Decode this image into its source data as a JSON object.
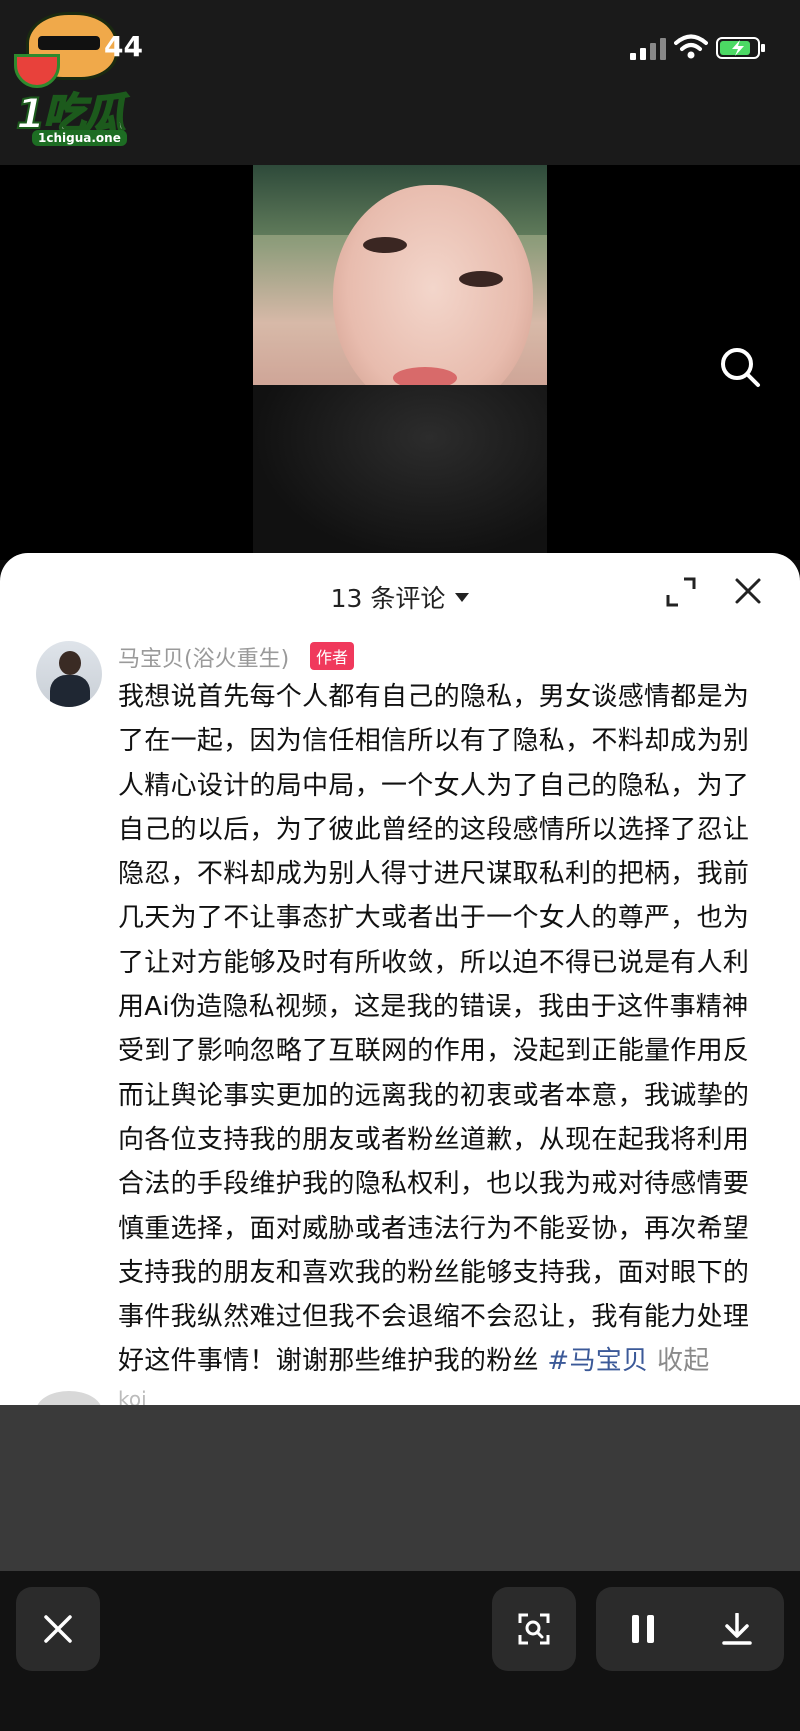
{
  "status_bar": {
    "time": "44",
    "watermark": {
      "brand": "1吃瓜",
      "site": "1chigua.one"
    }
  },
  "comments": {
    "header": "13 条评论",
    "author": {
      "name": "马宝贝(浴火重生)",
      "badge": "作者",
      "text": "我想说首先每个人都有自己的隐私，男女谈感情都是为了在一起，因为信任相信所以有了隐私，不料却成为别人精心设计的局中局，一个女人为了自己的隐私，为了自己的以后，为了彼此曾经的这段感情所以选择了忍让隐忍，不料却成为别人得寸进尺谋取私利的把柄，我前几天为了不让事态扩大或者出于一个女人的尊严，也为了让对方能够及时有所收敛，所以迫不得已说是有人利用Ai伪造隐私视频，这是我的错误，我由于这件事精神受到了影响忽略了互联网的作用，没起到正能量作用反而让舆论事实更加的远离我的初衷或者本意，我诚挚的向各位支持我的朋友或者粉丝道歉，从现在起我将利用合法的手段维护我的隐私权利，也以我为戒对待感情要慎重选择，面对威胁或者违法行为不能妥协，再次希望支持我的朋友和喜欢我的粉丝能够支持我，面对眼下的事件我纵然难过但我不会退缩不会忍让，我有能力处理好这件事情！谢谢那些维护我的粉丝 ",
      "hashtag": "#马宝贝",
      "collapse": " 收起"
    },
    "next_comment_name": "koi"
  },
  "colors": {
    "badge": "#f0395c",
    "hashtag": "#3b5998",
    "panel_bg": "#ffffff"
  }
}
